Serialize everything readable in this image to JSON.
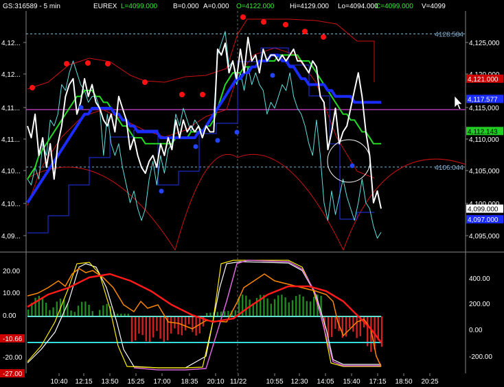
{
  "header": {
    "symbol": "GS:316589 - 5 min",
    "exchange": "EUREX",
    "last": "L=4099.000",
    "bid": "B=0.000",
    "ask": "A=0.000",
    "open": "O=4122.000",
    "high": "Hi=4129.000",
    "low": "Lo=4094.000",
    "close": "C=4099.000",
    "volume": "V=4099"
  },
  "colors": {
    "background": "#000000",
    "price": "#ffffff",
    "cyan_line": "#5fe0e0",
    "green_ma": "#22dd22",
    "blue_ma": "#1a2cff",
    "red": "#ff1a1a",
    "magenta": "#cc44cc",
    "orange": "#ff8800",
    "yellow": "#ffee00",
    "hist_green": "#228822",
    "hist_red": "#cc2222"
  },
  "price_panel": {
    "left_axis_ticks": [
      "4,12...",
      "4,12...",
      "4,11...",
      "4,11...",
      "4,10...",
      "4,10...",
      "4,09..."
    ],
    "right_axis_ticks": [
      "4,125,000",
      "4,120,000",
      "4,115,000",
      "4,110,000",
      "4,105,000",
      "4,100,000",
      "4,095,000"
    ],
    "ref_labels": [
      {
        "text": "4128.584",
        "price": 4128.584
      },
      {
        "text": "4106.044",
        "price": 4106.044
      }
    ],
    "value_tags": [
      {
        "text": "4,121.000",
        "price": 4121.0,
        "bg": "#cc0000",
        "fg": "#ffffff"
      },
      {
        "text": "4,117.577",
        "price": 4117.577,
        "bg": "#1a2cff",
        "fg": "#ffffff"
      },
      {
        "text": "4,112.143",
        "price": 4112.143,
        "bg": "#22cc22",
        "fg": "#000000"
      },
      {
        "text": "4,099.000",
        "price": 4099.0,
        "bg": "#ffffff",
        "fg": "#000000"
      },
      {
        "text": "4,097.000",
        "price": 4097.2,
        "bg": "#1a2cff",
        "fg": "#ffffff"
      }
    ]
  },
  "indicator_panel": {
    "left_axis_ticks": [
      "20.00",
      "10.00",
      "0.00",
      "-10.66",
      "-20.00",
      "-27.00"
    ],
    "right_axis_ticks": [
      "400.00",
      "200.00",
      "0.00",
      "-200.00"
    ]
  },
  "time_axis": [
    "10:40",
    "12:15",
    "13:50",
    "15:25",
    "17:00",
    "18:35",
    "20:10",
    "11/22",
    "10:55",
    "12:30",
    "14:05",
    "15:40",
    "17:15",
    "18:50",
    "20:25"
  ],
  "chart_data": {
    "type": "line",
    "title": "GS:316589 - 5 min",
    "y_range": [
      4092,
      4132
    ],
    "series": [
      {
        "name": "price",
        "values": [
          4113,
          4111,
          4115,
          4108,
          4111,
          4106,
          4110,
          4104,
          4110,
          4113,
          4118,
          4120,
          4121,
          4115,
          4117,
          4121,
          4118,
          4120,
          4117,
          4116,
          4114,
          4113,
          4115,
          4112,
          4118,
          4116,
          4114,
          4109,
          4111,
          4108,
          4106,
          4105,
          4107,
          4108,
          4106,
          4110,
          4108,
          4111,
          4109,
          4114,
          4111,
          4114,
          4112,
          4113,
          4112,
          4113,
          4111,
          4113,
          4112,
          4112,
          4126,
          4125,
          4127,
          4122,
          4124,
          4121,
          4126,
          4122,
          4128,
          4124,
          4125,
          4122,
          4126,
          4124,
          4125,
          4125,
          4124,
          4125,
          4124,
          4125,
          4126,
          4124,
          4124,
          4123,
          4122,
          4124,
          4123,
          4118,
          4117,
          4109,
          4112,
          4116,
          4110,
          4112,
          4113,
          4116,
          4119,
          4122,
          4118,
          4112,
          4108,
          4100,
          4102,
          4099
        ]
      },
      {
        "name": "cyan",
        "values": [
          4104,
          4103,
          4106,
          4104,
          4110,
          4108,
          4114,
          4113,
          4115,
          4120,
          4119,
          4122,
          4124,
          4122,
          4120,
          4119,
          4117,
          4118,
          4118,
          4116,
          4108,
          4115,
          4110,
          4108,
          4110,
          4106,
          4103,
          4100,
          4102,
          4099,
          4097,
          4099,
          4104,
          4107,
          4103,
          4108,
          4105,
          4109,
          4110,
          4115,
          4113,
          4116,
          4114,
          4112,
          4114,
          4113,
          4112,
          4113,
          4114,
          4115,
          4125,
          4127,
          4129,
          4123,
          4124,
          4120,
          4122,
          4119,
          4123,
          4120,
          4122,
          4120,
          4119,
          4115,
          4117,
          4116,
          4118,
          4120,
          4119,
          4122,
          4118,
          4116,
          4115,
          4113,
          4110,
          4108,
          4114,
          4108,
          4100,
          4097,
          4102,
          4098,
          4101,
          4104,
          4101,
          4099,
          4097,
          4100,
          4104,
          4100,
          4099,
          4096,
          4094,
          4095
        ]
      },
      {
        "name": "green",
        "values": [
          4104,
          4105,
          4106,
          4108,
          4109,
          4110,
          4111,
          4112,
          4113,
          4114,
          4115,
          4116,
          4117,
          4118,
          4118,
          4119,
          4119,
          4119,
          4118,
          4118,
          4117,
          4117,
          4116,
          4115,
          4114,
          4113,
          4113,
          4112,
          4111,
          4111,
          4111,
          4110,
          4110,
          4110,
          4110,
          4110,
          4110,
          4110,
          4110,
          4111,
          4111,
          4111,
          4111,
          4112,
          4112,
          4112,
          4112,
          4113,
          4113,
          4114,
          4116,
          4118,
          4120,
          4121,
          4122,
          4122,
          4122,
          4123,
          4123,
          4123,
          4123,
          4124,
          4124,
          4124,
          4124,
          4124,
          4125,
          4125,
          4125,
          4125,
          4125,
          4125,
          4124,
          4124,
          4124,
          4123,
          4122,
          4121,
          4120,
          4119,
          4118,
          4117,
          4116,
          4115,
          4115,
          4114,
          4114,
          4113,
          4112,
          4112,
          4111,
          4110,
          4110,
          4110
        ]
      },
      {
        "name": "blue",
        "values": [
          4100,
          4101,
          4102,
          4103,
          4104,
          4105,
          4106,
          4107,
          4108,
          4109,
          4110,
          4111,
          4112,
          4113,
          4114,
          4115,
          4115,
          4116,
          4116,
          4116,
          4116,
          4116,
          4116,
          4115,
          4115,
          4114,
          4114,
          4113,
          4113,
          4112,
          4112,
          4112,
          4112,
          4112,
          4112,
          4111,
          4111,
          4111,
          4111,
          4111,
          4111,
          4111,
          4111,
          4111,
          4111,
          4112,
          4112,
          4113,
          4114,
          4115,
          4116,
          4117,
          4118,
          4119,
          4120,
          4121,
          4121,
          4122,
          4122,
          4123,
          4123,
          4124,
          4124,
          4124,
          4125,
          4125,
          4125,
          4124,
          4124,
          4123,
          4123,
          4122,
          4121,
          4121,
          4120,
          4120,
          4120,
          4120,
          4120,
          4119,
          4119,
          4118,
          4118,
          4118,
          4118,
          4118,
          4117,
          4117,
          4117,
          4117,
          4117,
          4117,
          4117,
          4117
        ]
      }
    ]
  }
}
